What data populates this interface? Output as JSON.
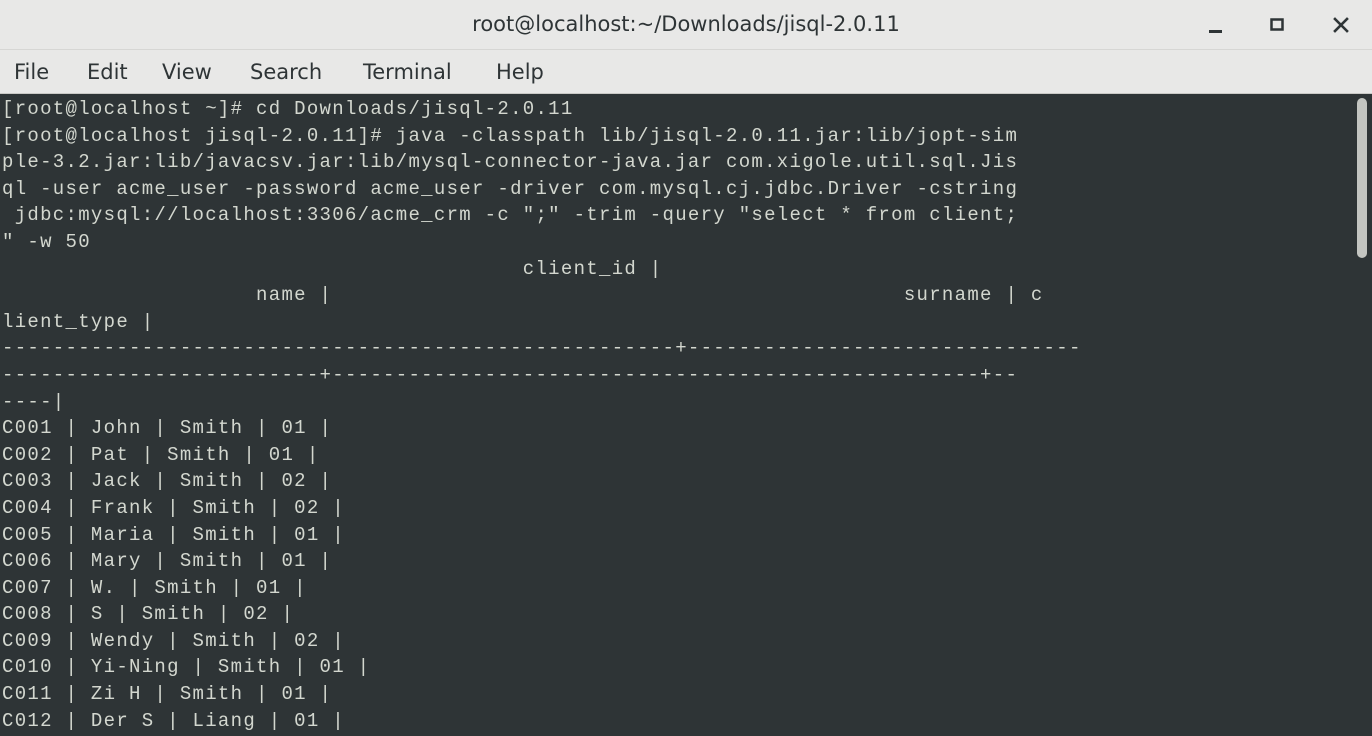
{
  "window": {
    "title": "root@localhost:~/Downloads/jisql-2.0.11"
  },
  "controls": {
    "minimize_icon": "minimize-icon",
    "maximize_icon": "maximize-icon",
    "close_icon": "close-icon"
  },
  "menu": {
    "items": [
      "File",
      "Edit",
      "View",
      "Search",
      "Terminal",
      "Help"
    ]
  },
  "terminal": {
    "lines": [
      "[root@localhost ~]# cd Downloads/jisql-2.0.11",
      "[root@localhost jisql-2.0.11]# java -classpath lib/jisql-2.0.11.jar:lib/jopt-sim",
      "ple-3.2.jar:lib/javacsv.jar:lib/mysql-connector-java.jar com.xigole.util.sql.Jis",
      "ql -user acme_user -password acme_user -driver com.mysql.cj.jdbc.Driver -cstring",
      " jdbc:mysql://localhost:3306/acme_crm -c \";\" -trim -query \"select * from client;",
      "\" -w 50",
      "                                         client_id |",
      "                    name |                                             surname | c",
      "lient_type |",
      "-----------------------------------------------------+-------------------------------",
      "-------------------------+---------------------------------------------------+--",
      "----|",
      "C001 | John | Smith | 01 |",
      "C002 | Pat | Smith | 01 |",
      "C003 | Jack | Smith | 02 |",
      "C004 | Frank | Smith | 02 |",
      "C005 | Maria | Smith | 01 |",
      "C006 | Mary | Smith | 01 |",
      "C007 | W. | Smith | 01 |",
      "C008 | S | Smith | 02 |",
      "C009 | Wendy | Smith | 02 |",
      "C010 | Yi-Ning | Smith | 01 |",
      "C011 | Zi H | Smith | 01 |",
      "C012 | Der S | Liang | 01 |"
    ]
  }
}
